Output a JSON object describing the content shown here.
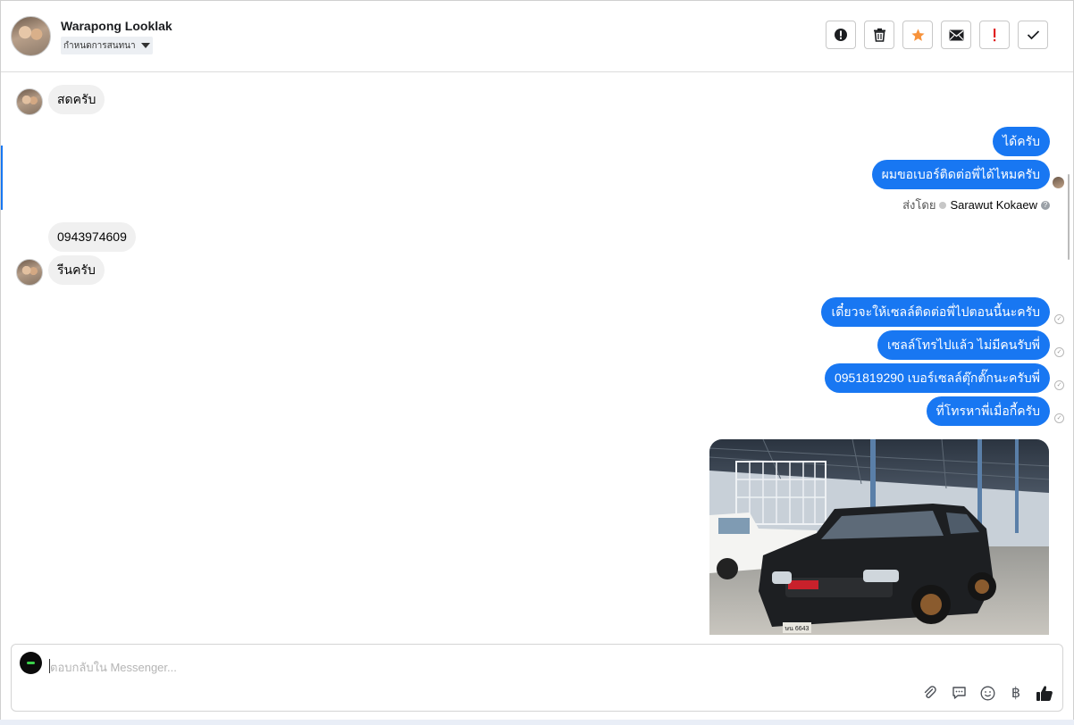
{
  "header": {
    "contact_name": "Warapong Looklak",
    "stage_label": "กำหนดการสนทนา"
  },
  "toolbar": {
    "buttons": [
      {
        "name": "report-icon"
      },
      {
        "name": "trash-icon"
      },
      {
        "name": "star-icon",
        "color": "#f7923a"
      },
      {
        "name": "envelope-icon"
      },
      {
        "name": "exclamation-icon",
        "color": "#e02020"
      },
      {
        "name": "check-icon"
      }
    ]
  },
  "messages": {
    "in_1": "สดครับ",
    "out_1": "ได้ครับ",
    "out_2": "ผมขอเบอร์ติดต่อพี่ได้ไหมครับ",
    "sent_by_prefix": "ส่งโดย",
    "sent_by_name": "Sarawut Kokaew",
    "in_2": "0943974609",
    "in_3": "รีนครับ",
    "out_3": "เดี๋ยวจะให้เซลล์ติดต่อพี่ไปตอนนี้นะครับ",
    "out_4": "เซลล์โทรไปแล้ว ไม่มีคนรับพี่",
    "out_5": "0951819290 เบอร์เซลล์ตุ๊กตั๊กนะครับพี่",
    "out_6": "ที่โทรหาพี่เมื่อกี้ครับ",
    "photo_plate": "ษน 6643"
  },
  "composer": {
    "placeholder": "ตอบกลับใน Messenger...",
    "tools": [
      "paperclip-icon",
      "speech-bubble-icon",
      "smiley-icon",
      "baht-icon",
      "thumbs-up-icon"
    ],
    "baht_symbol": "฿"
  },
  "colors": {
    "outgoing_bubble": "#1877f2",
    "incoming_bubble": "#f0f0f0"
  }
}
